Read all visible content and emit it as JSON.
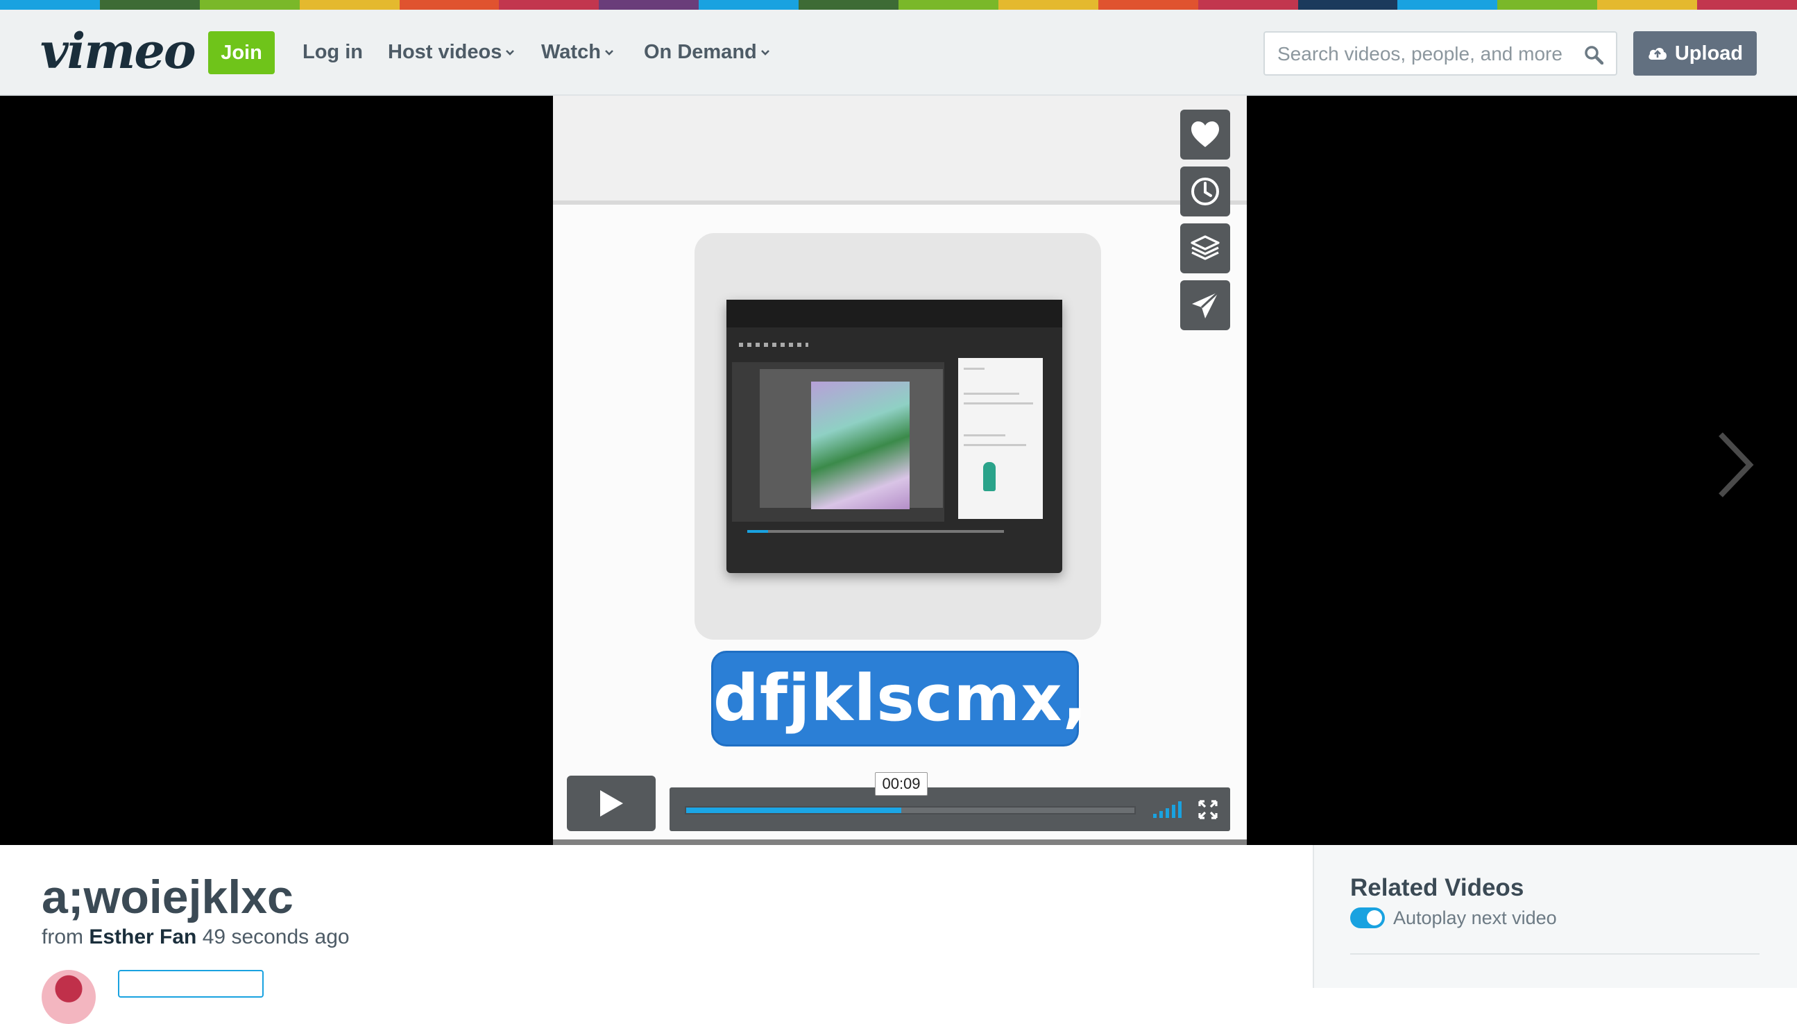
{
  "header": {
    "logo": "vimeo",
    "join_label": "Join",
    "login_label": "Log in",
    "nav": [
      {
        "label": "Host videos",
        "icon": "chevron-down-icon"
      },
      {
        "label": "Watch",
        "icon": "chevron-down-icon"
      },
      {
        "label": "On Demand",
        "icon": "chevron-down-icon"
      }
    ],
    "search_placeholder": "Search videos, people, and more",
    "upload_label": "Upload"
  },
  "player": {
    "caption_text": "dfjklscmx,",
    "time_tooltip": "00:09",
    "progress_fraction": 0.48,
    "side_actions": [
      "heart-icon",
      "clock-icon",
      "layers-icon",
      "paper-plane-icon"
    ]
  },
  "video": {
    "title": "a;woiejklxc",
    "from_label": "from",
    "author": "Esther Fan",
    "time_ago": "49 seconds ago"
  },
  "sidebar": {
    "related_title": "Related Videos",
    "autoplay_label": "Autoplay next video",
    "autoplay_on": true
  },
  "colors": {
    "brand_green": "#6fc41a",
    "accent_blue": "#19a2e0",
    "header_bg": "#eef1f2",
    "upload_bg": "#627080",
    "caption_blue": "#2b7fd6"
  }
}
